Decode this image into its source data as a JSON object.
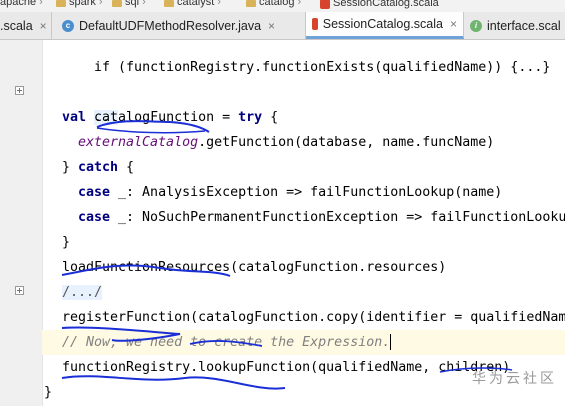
{
  "breadcrumb": [
    "apache",
    "spark",
    "sql",
    "catalyst",
    "catalog",
    "SessionCatalog.scala"
  ],
  "tabs": [
    {
      "label": ".scala",
      "icon": "scala-file-icon",
      "active": false
    },
    {
      "label": "DefaultUDFMethodResolver.java",
      "icon": "java-class-icon",
      "active": false
    },
    {
      "label": "SessionCatalog.scala",
      "icon": "scala-file-icon",
      "active": true
    },
    {
      "label": "interface.scal",
      "icon": "scala-file-icon",
      "active": false
    }
  ],
  "code": {
    "l0": "if (functionRegistry.functionExists(qualifiedName)) {...}",
    "l1": "...",
    "l2_kw": "val",
    "l2_rest": " catalogFunction = ",
    "l2_try": "try",
    "l2_end": " {",
    "l3_ital": "externalCatalog",
    "l3_rest": ".getFunction(database, name.funcName)",
    "l4_open": "} ",
    "l4_kw": "catch",
    "l4_end": " {",
    "l5_kw": "case",
    "l5_rest": " _: AnalysisException => failFunctionLookup(name)",
    "l6_kw": "case",
    "l6_rest": " _: NoSuchPermanentFunctionException => failFunctionLooku",
    "l7": "}",
    "l8": "loadFunctionResources(catalogFunction.resources)",
    "l9": "/.../",
    "l10": "registerFunction(catalogFunction.copy(identifier = qualifiedNam",
    "l11": "// Now, we need to create the Expression.",
    "l12": "functionRegistry.lookupFunction(qualifiedName, children)",
    "l13": "}"
  },
  "watermark": "华为云社区"
}
